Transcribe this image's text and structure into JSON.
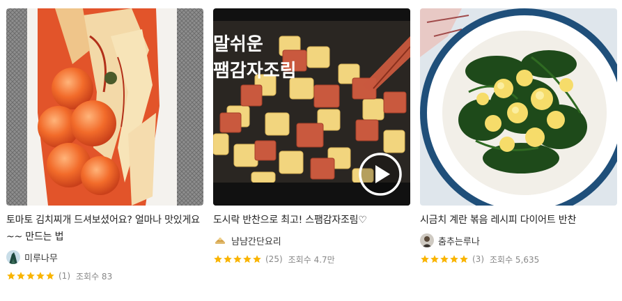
{
  "cards": [
    {
      "title": "토마토 김치찌개 드셔보셨어요? 얼마나 맛있게요~~ 만드는 법",
      "author": "미루나무",
      "rating": 5,
      "reviews": "(1)",
      "views": "조회수 83",
      "has_video": false,
      "thumbnail": "kimchi-with-cherry-tomatoes"
    },
    {
      "title": "도시락 반찬으로 최고! 스팸감자조림♡",
      "author": "냠냠간단요리",
      "rating": 5,
      "reviews": "(25)",
      "views": "조회수 4.7만",
      "has_video": true,
      "thumbnail_overlay_text": "말쉬운\n팸감자조림",
      "thumbnail": "spam-potato-braise"
    },
    {
      "title": "시금치 계란 볶음 레시피 다이어트 반찬",
      "author": "춤추는루나",
      "rating": 5,
      "reviews": "(3)",
      "views": "조회수 5,635",
      "has_video": false,
      "thumbnail": "spinach-egg-stirfry"
    }
  ],
  "colors": {
    "star": "#f9b400",
    "meta_text": "#888888",
    "title_text": "#222222"
  },
  "icons": [
    "star-icon",
    "play-icon",
    "avatar"
  ]
}
